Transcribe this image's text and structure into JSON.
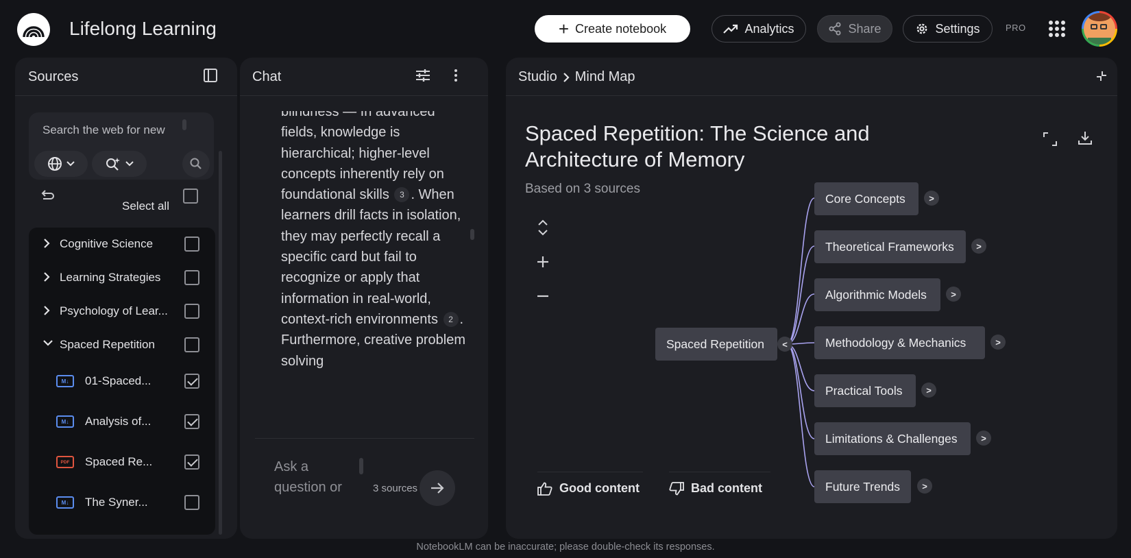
{
  "header": {
    "app_title": "Lifelong Learning",
    "create_label": "Create notebook",
    "analytics_label": "Analytics",
    "share_label": "Share",
    "settings_label": "Settings",
    "pro_badge": "PRO"
  },
  "sources": {
    "title": "Sources",
    "search_placeholder": "Search the web for new",
    "select_all_label": "Select all",
    "folders": [
      {
        "label": "Cognitive Science",
        "expanded": false,
        "checked": false
      },
      {
        "label": "Learning Strategies",
        "expanded": false,
        "checked": false
      },
      {
        "label": "Psychology of Lear...",
        "expanded": false,
        "checked": false
      },
      {
        "label": "Spaced Repetition",
        "expanded": true,
        "checked": false
      }
    ],
    "files": [
      {
        "label": "01-Spaced...",
        "type": "markdown",
        "icon_text": "M↓",
        "checked": true
      },
      {
        "label": "Analysis of...",
        "type": "markdown",
        "icon_text": "M↓",
        "checked": true
      },
      {
        "label": "Spaced Re...",
        "type": "pdf",
        "icon_text": "PDF",
        "checked": true
      },
      {
        "label": "The Syner...",
        "type": "markdown",
        "icon_text": "M↓",
        "checked": false
      }
    ]
  },
  "chat": {
    "title": "Chat",
    "partial_top": "blindness",
    "msg_1": "— In advanced fields, knowledge is hierarchical; higher-level concepts inherently rely on foundational skills",
    "cite_1": "3",
    "msg_2": ". When learners drill facts in isolation, they may perfectly recall a specific card but fail to recognize or apply that information in real-world, context-rich environments",
    "cite_2": "2",
    "msg_3": ". Furthermore, creative problem solving",
    "input_placeholder": "Ask a question or",
    "sources_count": "3 sources"
  },
  "studio": {
    "breadcrumb_root": "Studio",
    "breadcrumb_current": "Mind Map",
    "title": "Spaced Repetition: The Science and Architecture of Memory",
    "subtitle": "Based on 3 sources",
    "root_node": "Spaced Repetition",
    "root_toggle": "<",
    "child_toggle": ">",
    "children": [
      "Core Concepts",
      "Theoretical Frameworks",
      "Algorithmic Models",
      "Methodology & Mechanics",
      "Practical Tools",
      "Limitations & Challenges",
      "Future Trends"
    ],
    "good_label": "Good content",
    "bad_label": "Bad content"
  },
  "footer": "NotebookLM can be inaccurate; please double-check its responses.",
  "colors": {
    "background": "#131418",
    "panel": "#1c1d22",
    "node": "#3f4049",
    "connector": "#a9a3f0",
    "markdown_icon": "#5b8def",
    "pdf_icon": "#e0553f"
  }
}
